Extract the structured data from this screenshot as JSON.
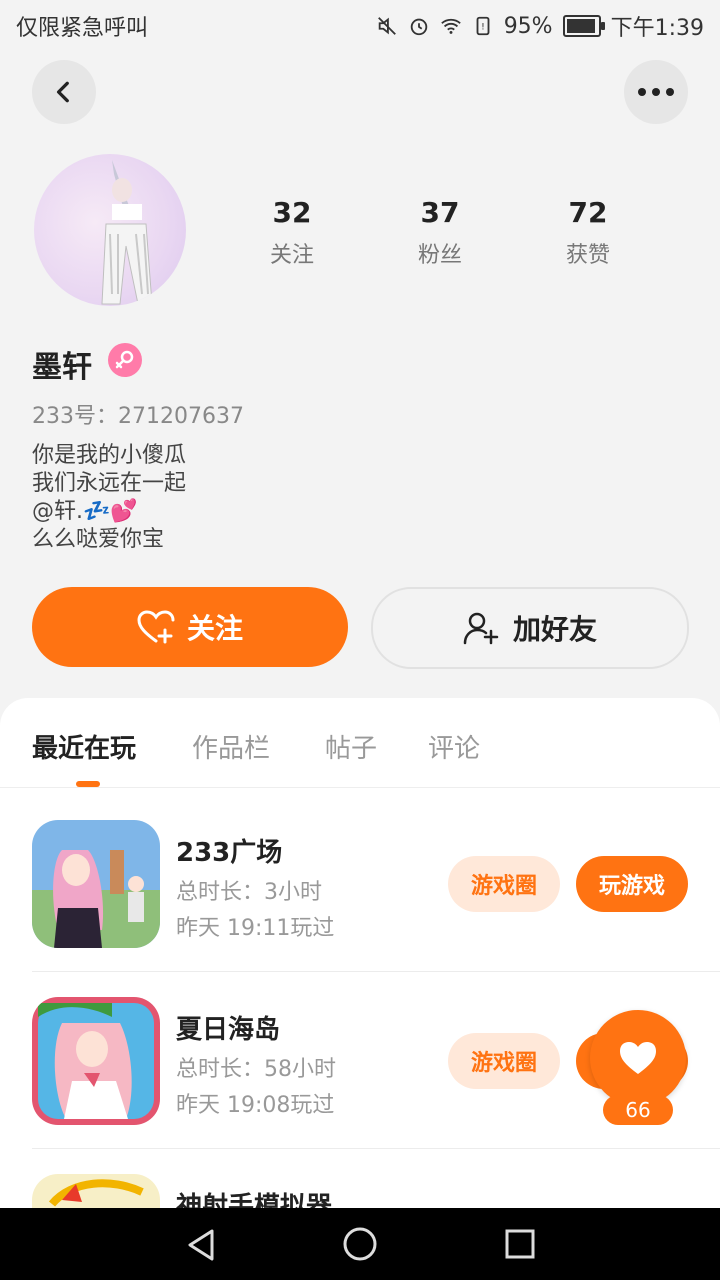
{
  "status_bar": {
    "carrier": "仅限紧急呼叫",
    "battery": "95%",
    "time": "下午1:39"
  },
  "profile": {
    "stats": [
      {
        "value": "32",
        "label": "关注"
      },
      {
        "value": "37",
        "label": "粉丝"
      },
      {
        "value": "72",
        "label": "获赞"
      }
    ],
    "name": "墨轩",
    "uid": "233号：271207637",
    "bio": [
      "你是我的小傻瓜",
      "我们永远在一起",
      "@轩.💤💕",
      "么么哒爱你宝"
    ]
  },
  "actions": {
    "follow": "关注",
    "add_friend": "加好友"
  },
  "tabs": [
    "最近在玩",
    "作品栏",
    "帖子",
    "评论"
  ],
  "games": [
    {
      "title": "233广场",
      "duration": "总时长：3小时",
      "last_played": "昨天 19:11玩过",
      "circle_label": "游戏圈",
      "play_label": "玩游戏"
    },
    {
      "title": "夏日海岛",
      "duration": "总时长：58小时",
      "last_played": "昨天 19:08玩过",
      "circle_label": "游戏圈",
      "play_label": "玩游戏"
    },
    {
      "title": "神射手模拟器"
    }
  ],
  "like_fab": {
    "count": "66"
  },
  "colors": {
    "accent": "#ff7312",
    "badge_female": "#ff7ba9"
  }
}
